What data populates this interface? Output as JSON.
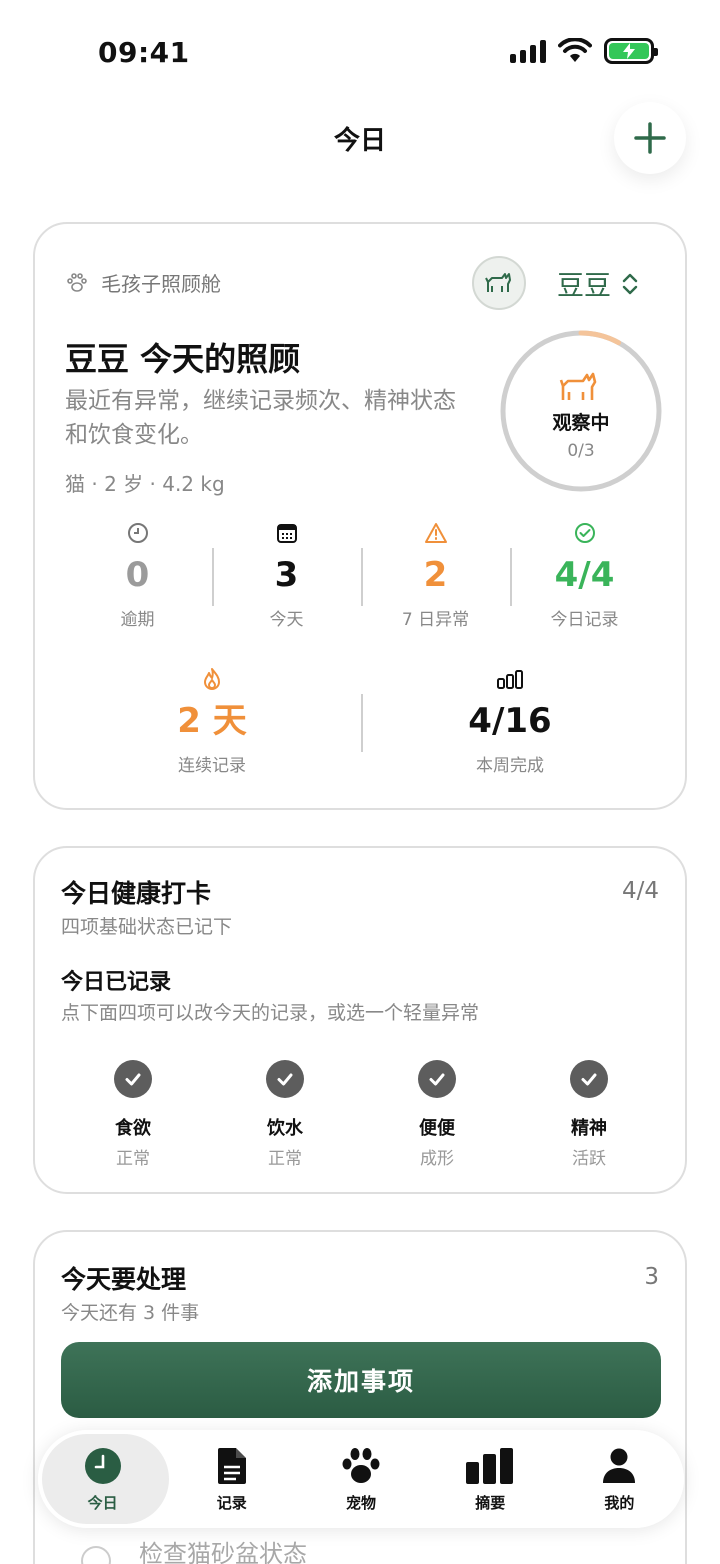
{
  "status_bar": {
    "time": "09:41"
  },
  "header": {
    "title": "今日",
    "add_icon": "plus-icon"
  },
  "pet_card": {
    "brand_label": "毛孩子照顾舱",
    "brand_icon": "paw-icon",
    "pet_name": "豆豆",
    "title": "豆豆 今天的照顾",
    "description": "最近有异常，继续记录频次、精神状态和饮食变化。",
    "meta": "猫 · 2 岁 · 4.2 kg",
    "status": {
      "label": "观察中",
      "count": "0/3",
      "progress": 0.08
    },
    "stats": [
      {
        "icon": "clock-icon",
        "value": "0",
        "label": "逾期",
        "color": "#9b9b9b"
      },
      {
        "icon": "calendar-icon",
        "value": "3",
        "label": "今天",
        "color": "#111111"
      },
      {
        "icon": "warning-icon",
        "value": "2",
        "label": "7 日异常",
        "color": "#f0903a"
      },
      {
        "icon": "check-circle-icon",
        "value": "4/4",
        "label": "今日记录",
        "color": "#3ab45a"
      }
    ],
    "stats2": [
      {
        "icon": "flame-icon",
        "value": "2 天",
        "label": "连续记录",
        "color": "#f0903a"
      },
      {
        "icon": "bars-icon",
        "value": "4/16",
        "label": "本周完成",
        "color": "#111111"
      }
    ]
  },
  "health_card": {
    "title": "今日健康打卡",
    "count": "4/4",
    "subtitle": "四项基础状态已记下",
    "recorded_title": "今日已记录",
    "recorded_sub": "点下面四项可以改今天的记录，或选一个轻量异常",
    "items": [
      {
        "name": "食欲",
        "state": "正常"
      },
      {
        "name": "饮水",
        "state": "正常"
      },
      {
        "name": "便便",
        "state": "成形"
      },
      {
        "name": "精神",
        "state": "活跃"
      }
    ]
  },
  "todo_card": {
    "title": "今天要处理",
    "count": "3",
    "subtitle": "今天还有 3 件事",
    "add_button": "添加事项",
    "last_item": "检查猫砂盆状态"
  },
  "tab_bar": [
    {
      "label": "今日",
      "icon": "clock-icon",
      "active": true
    },
    {
      "label": "记录",
      "icon": "document-icon",
      "active": false
    },
    {
      "label": "宠物",
      "icon": "paw-icon",
      "active": false
    },
    {
      "label": "摘要",
      "icon": "bar-chart-icon",
      "active": false
    },
    {
      "label": "我的",
      "icon": "person-icon",
      "active": false
    }
  ]
}
